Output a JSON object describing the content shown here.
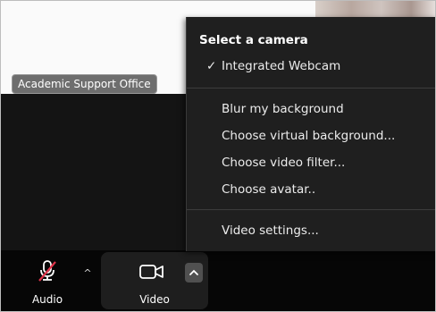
{
  "participant": {
    "name": "Academic Support Office"
  },
  "menu": {
    "header": "Select a camera",
    "selected_camera": "Integrated Webcam",
    "items": [
      "Blur my background",
      "Choose virtual background...",
      "Choose video filter...",
      "Choose avatar..",
      "Video settings..."
    ]
  },
  "toolbar": {
    "audio_label": "Audio",
    "video_label": "Video"
  },
  "colors": {
    "menu_bg": "#1f1f1f",
    "toolbar_bg": "#060606",
    "muted_slash": "#e0334a"
  },
  "icons": [
    "microphone-muted-icon",
    "chevron-up-icon",
    "video-camera-icon",
    "checkmark-icon"
  ]
}
